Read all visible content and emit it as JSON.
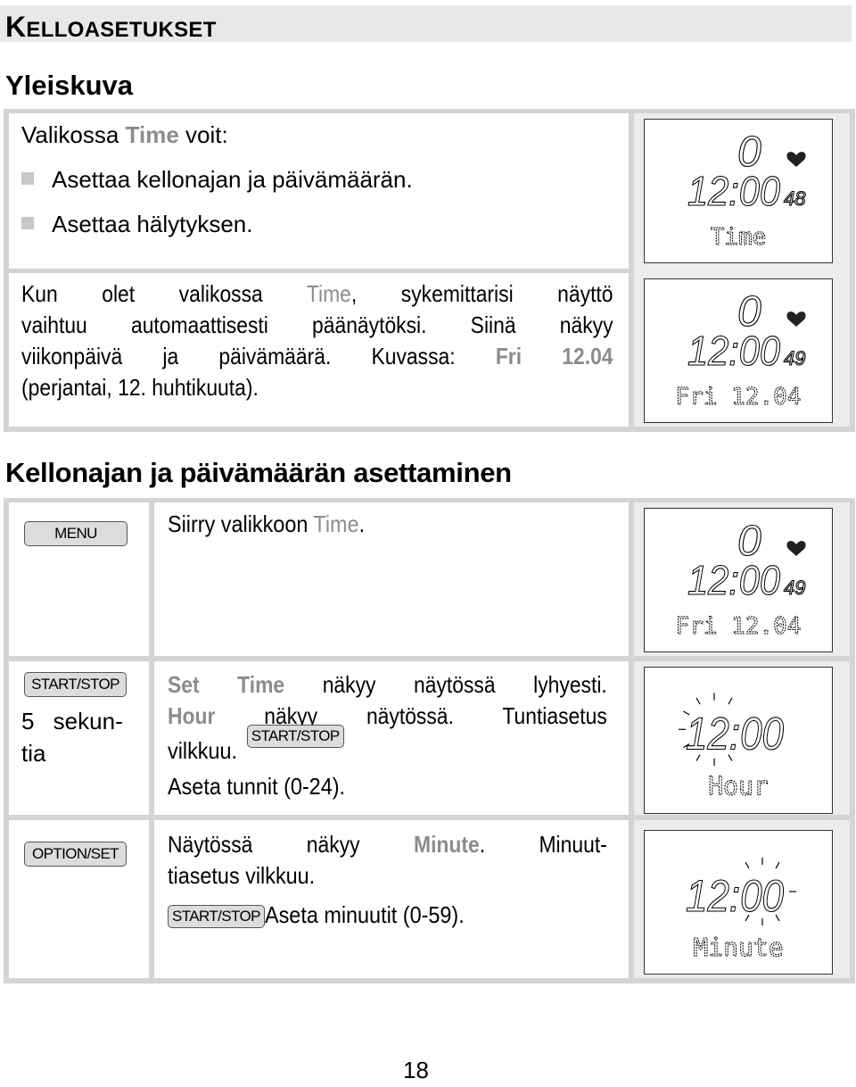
{
  "chapter": {
    "first_letter": "K",
    "rest": "ELLOASETUKSET"
  },
  "overview": {
    "heading": "Yleiskuva",
    "intro_prefix": "Valikossa ",
    "intro_highlight": "Time",
    "intro_suffix": " voit:",
    "bullets": [
      "Asettaa kellonajan ja päivämäärän.",
      "Asettaa hälytyksen."
    ],
    "para_lines": [
      [
        "Kun olet valikossa ",
        "Time",
        ", sykemittarisi näyttö"
      ],
      [
        "vaihtuu automaattisesti päänäytöksi. Siinä näkyy"
      ],
      [
        "viikonpäivä ja päivämäärä. Kuvassa: ",
        "Fri 12.04"
      ],
      [
        "(perjantai, 12. huhtikuuta)."
      ]
    ],
    "displays": [
      {
        "top": "0",
        "time": "12:00",
        "seconds": "48",
        "label": "Time",
        "icon": "heart-icon"
      },
      {
        "top": "0",
        "time": "12:00",
        "seconds": "49",
        "label": "Fri 12.04",
        "icon": "heart-icon"
      }
    ]
  },
  "setting": {
    "heading": "Kellonajan ja päivämäärän asettaminen",
    "steps": [
      {
        "key": "MENU",
        "text_prefix": "Siirry valikkoon ",
        "text_highlight": "Time",
        "text_suffix": ".",
        "display": {
          "top": "0",
          "time": "12:00",
          "seconds": "49",
          "label": "Fri 12.04"
        }
      },
      {
        "key": "START/STOP",
        "key_note": [
          "5 sekun-",
          "tia"
        ],
        "line1_highlight": "Set Time",
        "line1_rest": " näkyy näytössä lyhyesti.",
        "line2_highlight": "Hour",
        "line2_rest": " näkyy näytössä. Tuntiasetus",
        "line3_text": "vilkkuu.",
        "line3_key": "START/STOP",
        "line4_text": "Aseta tunnit (0-24).",
        "display": {
          "time": "12:00",
          "label": "Hour",
          "blinking": "hours"
        }
      },
      {
        "key": "OPTION/SET",
        "line1_prefix": "Näytössä näkyy ",
        "line1_highlight": "Minute",
        "line1_suffix": ". Minuut-",
        "line2_text": "tiasetus vilkkuu.",
        "line3_key": "START/STOP",
        "line3_text": " Aseta minuutit (0-59).",
        "display": {
          "time": "12:00",
          "label": "Minute",
          "blinking": "minutes"
        }
      }
    ]
  },
  "page_number": "18"
}
